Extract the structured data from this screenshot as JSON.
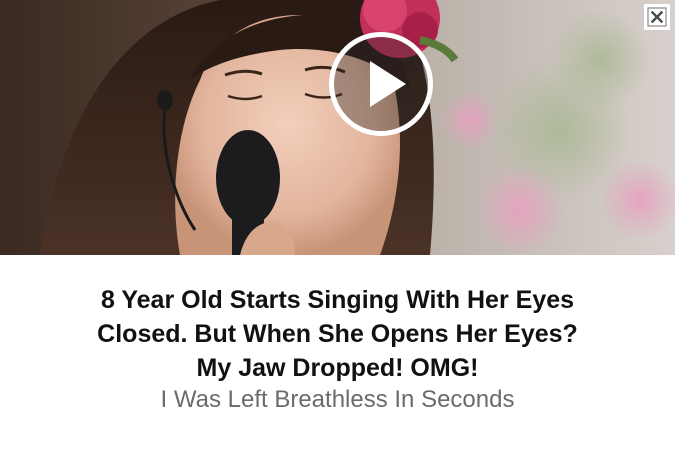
{
  "ad": {
    "headline_lines": [
      "8 Year Old Starts Singing With Her Eyes",
      "Closed. But When She Opens Her Eyes?",
      "My Jaw Dropped! OMG!"
    ],
    "subline": "I Was Left Breathless In Seconds"
  },
  "icons": {
    "play": "play-icon",
    "close": "close-icon"
  },
  "colors": {
    "headline": "#111111",
    "subline": "#6b6b6b",
    "background": "#ffffff"
  }
}
